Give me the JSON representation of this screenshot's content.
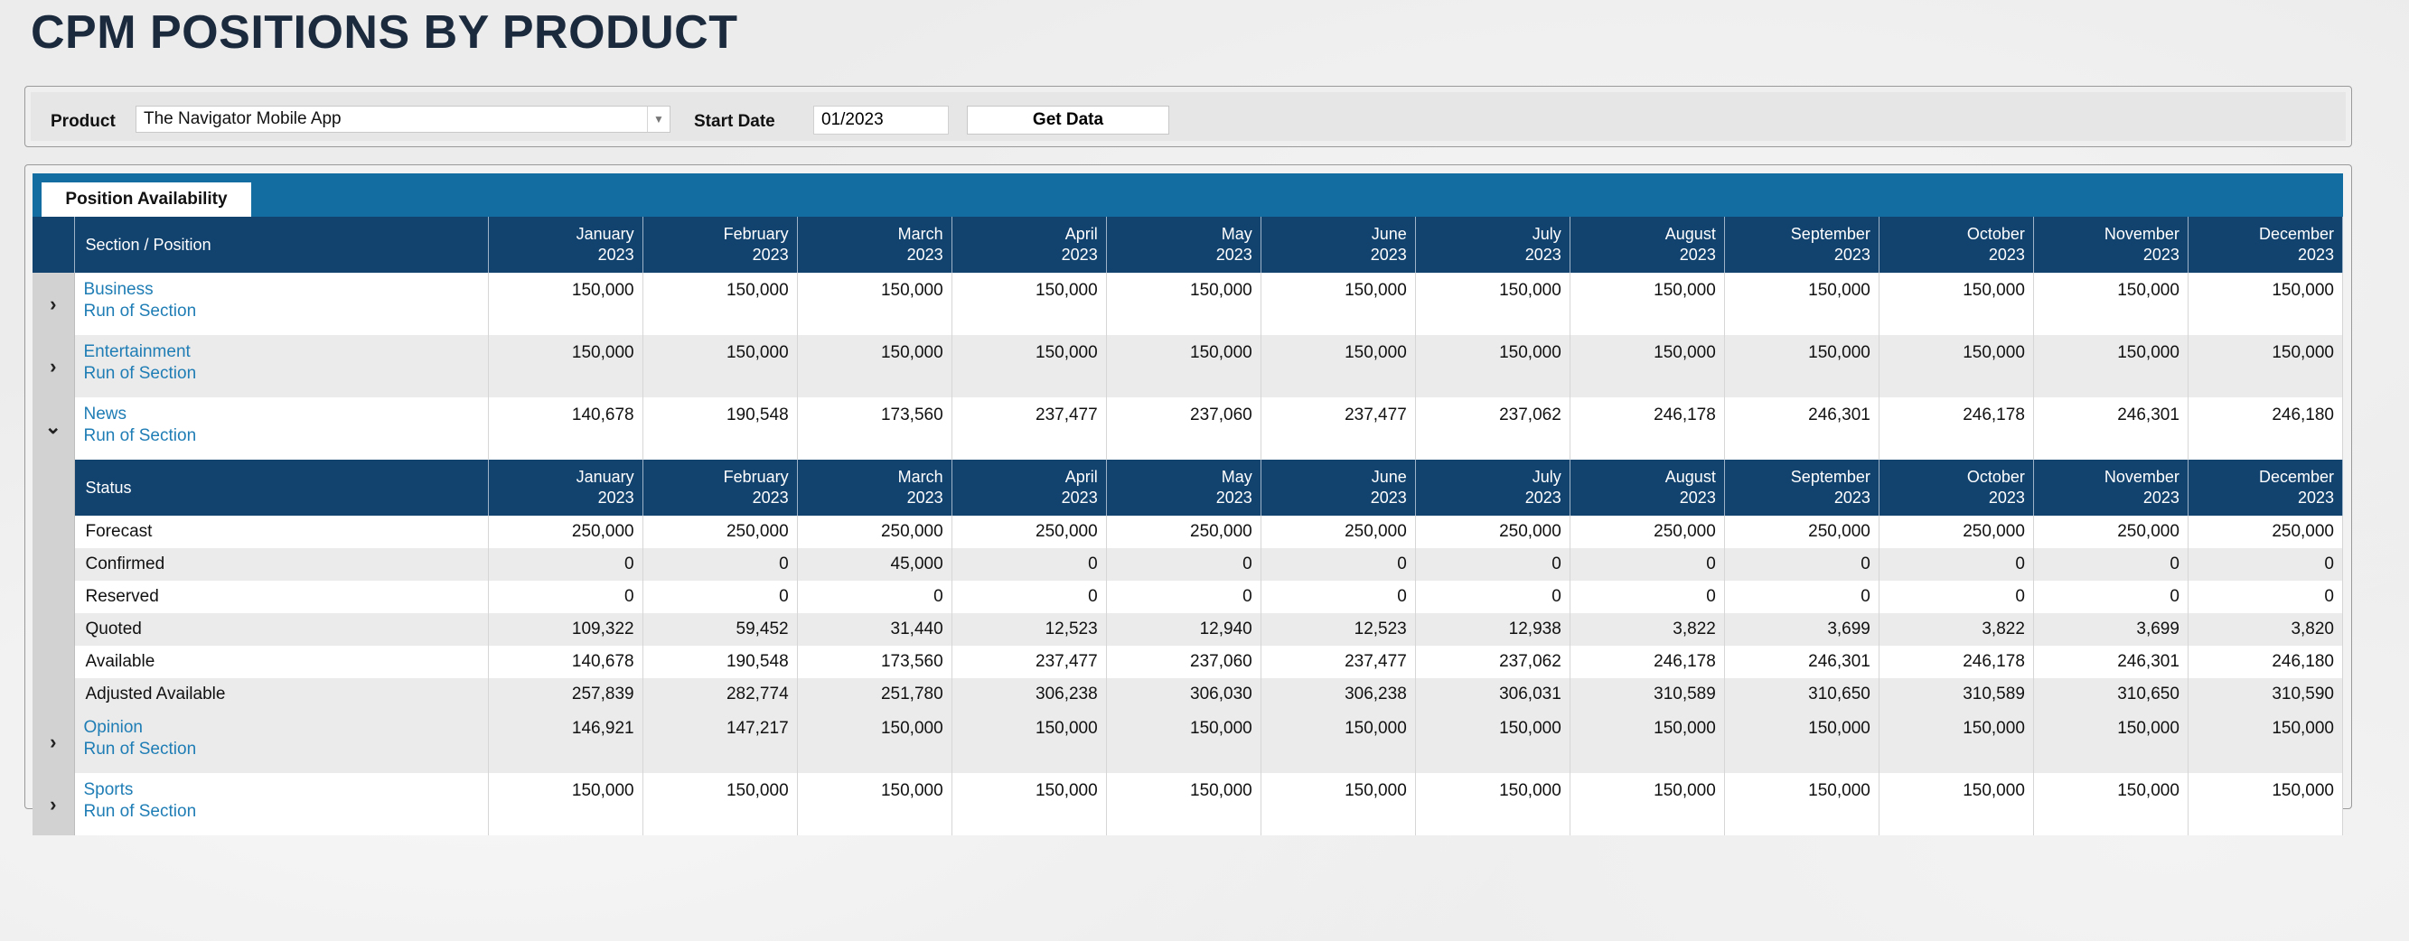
{
  "page": {
    "title": "CPM POSITIONS BY PRODUCT"
  },
  "filters": {
    "product_label": "Product",
    "product_value": "The Navigator Mobile App",
    "start_date_label": "Start Date",
    "start_date_value": "01/2023",
    "get_data_label": "Get Data"
  },
  "tab": {
    "label": "Position Availability"
  },
  "table": {
    "section_header": "Section / Position",
    "status_header": "Status",
    "months": [
      {
        "m": "January",
        "y": "2023"
      },
      {
        "m": "February",
        "y": "2023"
      },
      {
        "m": "March",
        "y": "2023"
      },
      {
        "m": "April",
        "y": "2023"
      },
      {
        "m": "May",
        "y": "2023"
      },
      {
        "m": "June",
        "y": "2023"
      },
      {
        "m": "July",
        "y": "2023"
      },
      {
        "m": "August",
        "y": "2023"
      },
      {
        "m": "September",
        "y": "2023"
      },
      {
        "m": "October",
        "y": "2023"
      },
      {
        "m": "November",
        "y": "2023"
      },
      {
        "m": "December",
        "y": "2023"
      }
    ],
    "sections": [
      {
        "name": "Business",
        "position": "Run of Section",
        "expanded": false,
        "values": [
          "150,000",
          "150,000",
          "150,000",
          "150,000",
          "150,000",
          "150,000",
          "150,000",
          "150,000",
          "150,000",
          "150,000",
          "150,000",
          "150,000"
        ]
      },
      {
        "name": "Entertainment",
        "position": "Run of Section",
        "expanded": false,
        "values": [
          "150,000",
          "150,000",
          "150,000",
          "150,000",
          "150,000",
          "150,000",
          "150,000",
          "150,000",
          "150,000",
          "150,000",
          "150,000",
          "150,000"
        ]
      },
      {
        "name": "News",
        "position": "Run of Section",
        "expanded": true,
        "values": [
          "140,678",
          "190,548",
          "173,560",
          "237,477",
          "237,060",
          "237,477",
          "237,062",
          "246,178",
          "246,301",
          "246,178",
          "246,301",
          "246,180"
        ],
        "statuses": [
          {
            "label": "Forecast",
            "values": [
              "250,000",
              "250,000",
              "250,000",
              "250,000",
              "250,000",
              "250,000",
              "250,000",
              "250,000",
              "250,000",
              "250,000",
              "250,000",
              "250,000"
            ]
          },
          {
            "label": "Confirmed",
            "values": [
              "0",
              "0",
              "45,000",
              "0",
              "0",
              "0",
              "0",
              "0",
              "0",
              "0",
              "0",
              "0"
            ]
          },
          {
            "label": "Reserved",
            "values": [
              "0",
              "0",
              "0",
              "0",
              "0",
              "0",
              "0",
              "0",
              "0",
              "0",
              "0",
              "0"
            ]
          },
          {
            "label": "Quoted",
            "values": [
              "109,322",
              "59,452",
              "31,440",
              "12,523",
              "12,940",
              "12,523",
              "12,938",
              "3,822",
              "3,699",
              "3,822",
              "3,699",
              "3,820"
            ]
          },
          {
            "label": "Available",
            "values": [
              "140,678",
              "190,548",
              "173,560",
              "237,477",
              "237,060",
              "237,477",
              "237,062",
              "246,178",
              "246,301",
              "246,178",
              "246,301",
              "246,180"
            ]
          },
          {
            "label": "Adjusted Available",
            "values": [
              "257,839",
              "282,774",
              "251,780",
              "306,238",
              "306,030",
              "306,238",
              "306,031",
              "310,589",
              "310,650",
              "310,589",
              "310,650",
              "310,590"
            ]
          }
        ]
      },
      {
        "name": "Opinion",
        "position": "Run of Section",
        "expanded": false,
        "values": [
          "146,921",
          "147,217",
          "150,000",
          "150,000",
          "150,000",
          "150,000",
          "150,000",
          "150,000",
          "150,000",
          "150,000",
          "150,000",
          "150,000"
        ]
      },
      {
        "name": "Sports",
        "position": "Run of Section",
        "expanded": false,
        "values": [
          "150,000",
          "150,000",
          "150,000",
          "150,000",
          "150,000",
          "150,000",
          "150,000",
          "150,000",
          "150,000",
          "150,000",
          "150,000",
          "150,000"
        ]
      }
    ]
  },
  "colors": {
    "header_bg": "#12426e",
    "tab_strip": "#146da0",
    "link": "#1f7db5"
  }
}
